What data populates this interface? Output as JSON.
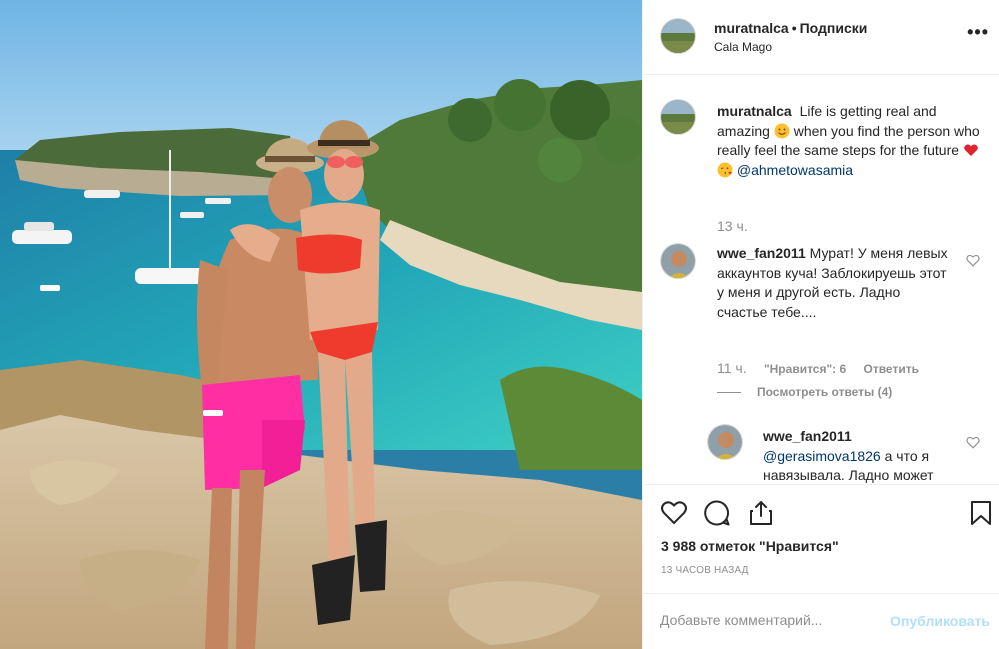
{
  "post": {
    "username": "muratnalca",
    "separator": "•",
    "follow_label": "Подписки",
    "location": "Cala Mago",
    "more_label": "•••"
  },
  "caption": {
    "username": "muratnalca",
    "text_part1": "Life is getting real and amazing",
    "text_part2": "when you find the person who really feel the same steps for the future",
    "mention": "@ahmetowasamia",
    "time": "13 ч."
  },
  "comments": [
    {
      "username": "wwe_fan2011",
      "text": "Мурат! У меня левых аккаунтов куча! Заблокируешь этот у меня и другой есть. Ладно счастье тебе....",
      "time": "11 ч.",
      "likes_label": "\"Нравится\": 6",
      "reply_label": "Ответить",
      "view_replies": "Посмотреть ответы (4)"
    },
    {
      "username": "wwe_fan2011",
      "mention": "@gerasimova1826",
      "text": "а что я навязывала. Ладно может"
    }
  ],
  "actions": {
    "like_icon": "heart-icon",
    "comment_icon": "comment-icon",
    "share_icon": "share-icon",
    "save_icon": "bookmark-icon",
    "likes_count": "3 988 отметок \"Нравится\"",
    "time_ago": "13 ЧАСОВ НАЗАД"
  },
  "add_comment": {
    "placeholder": "Добавьте комментарий...",
    "publish_label": "Опубликовать"
  },
  "colors": {
    "link": "#00376b",
    "muted": "#8e8e8e",
    "publish_disabled": "#b2dffc",
    "heart": "#ed4956",
    "border": "#efefef"
  }
}
